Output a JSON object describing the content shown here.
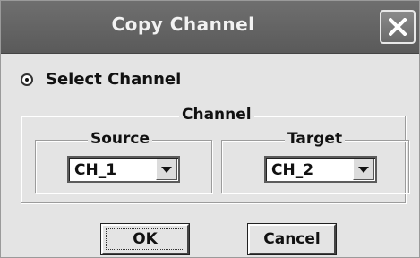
{
  "window": {
    "title": "Copy Channel",
    "close_icon": "close-icon"
  },
  "selection": {
    "radio_label": "Select Channel",
    "selected": true
  },
  "channel_group": {
    "label": "Channel",
    "source": {
      "label": "Source",
      "value": "CH_1"
    },
    "target": {
      "label": "Target",
      "value": "CH_2"
    }
  },
  "buttons": {
    "ok_label": "OK",
    "cancel_label": "Cancel"
  }
}
